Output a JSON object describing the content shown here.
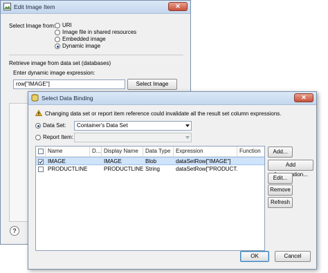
{
  "edit_dialog": {
    "title": "Edit Image Item",
    "select_image_label": "Select Image from:",
    "options": [
      "URI",
      "Image file in shared resources",
      "Embedded image",
      "Dynamic image"
    ],
    "selected_option": "Dynamic image",
    "group_label": "Retrieve image from data set (databases)",
    "expression_label": "Enter dynamic image expression:",
    "expression_value": "row[\"IMAGE\"]",
    "select_image_data_button": "Select Image Data..."
  },
  "binding_dialog": {
    "title": "Select Data Binding",
    "warning": "Changing data set or report item reference could invalidate all the result set column expressions.",
    "data_set_label": "Data Set:",
    "data_set_value": "Container's Data Set",
    "report_item_label": "Report Item:",
    "report_item_value": "",
    "table": {
      "columns": [
        "Name",
        "D...",
        "Display Name",
        "Data Type",
        "Expression",
        "Function"
      ],
      "rows": [
        {
          "checked": true,
          "name": "IMAGE",
          "d": "",
          "display_name": "IMAGE",
          "data_type": "Blob",
          "expression": "dataSetRow[\"IMAGE\"]",
          "function": ""
        },
        {
          "checked": false,
          "name": "PRODUCTLINE",
          "d": "",
          "display_name": "PRODUCTLINE",
          "data_type": "String",
          "expression": "dataSetRow[\"PRODUCT...",
          "function": ""
        }
      ]
    },
    "side_buttons": [
      "Add...",
      "Add Aggregation...",
      "Edit...",
      "Remove",
      "Refresh"
    ],
    "ok_button": "OK",
    "cancel_button": "Cancel"
  },
  "colors": {
    "accent": "#1b4a86",
    "selection": "#cfe3fb",
    "warning": "#e8b21e"
  }
}
